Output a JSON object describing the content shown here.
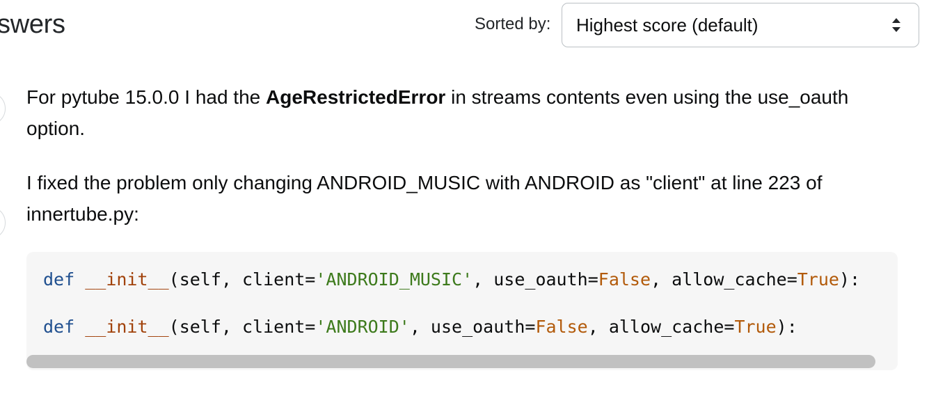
{
  "header": {
    "title": "swers",
    "sort_label": "Sorted by:",
    "sort_selected": "Highest score (default)"
  },
  "answer": {
    "p1_before": "For pytube 15.0.0 I had the ",
    "p1_bold": "AgeRestrictedError",
    "p1_after": " in streams contents even using the use_oauth option.",
    "p2": "I fixed the problem only changing ANDROID_MUSIC with ANDROID as \"client\" at line 223 of innertube.py:"
  },
  "code": {
    "line1": {
      "def": "def",
      "fn": "__init__",
      "open": "(self, client=",
      "client": "'ANDROID_MUSIC'",
      "mid": ", use_oauth=",
      "use_oauth": "False",
      "mid2": ", allow_cache=",
      "allow_cache": "True",
      "close": "):"
    },
    "line2": {
      "def": "def",
      "fn": "__init__",
      "open": "(self, client=",
      "client": "'ANDROID'",
      "mid": ", use_oauth=",
      "use_oauth": "False",
      "mid2": ", allow_cache=",
      "allow_cache": "True",
      "close": "):"
    }
  },
  "icons": {
    "select_arrows": "sort-arrows-icon",
    "vote": "vote-circle"
  },
  "colors": {
    "keyword": "#1f4f8f",
    "function": "#a1420b",
    "string": "#3d7a1c",
    "literal": "#b25a0a",
    "code_bg": "#f6f6f6"
  }
}
